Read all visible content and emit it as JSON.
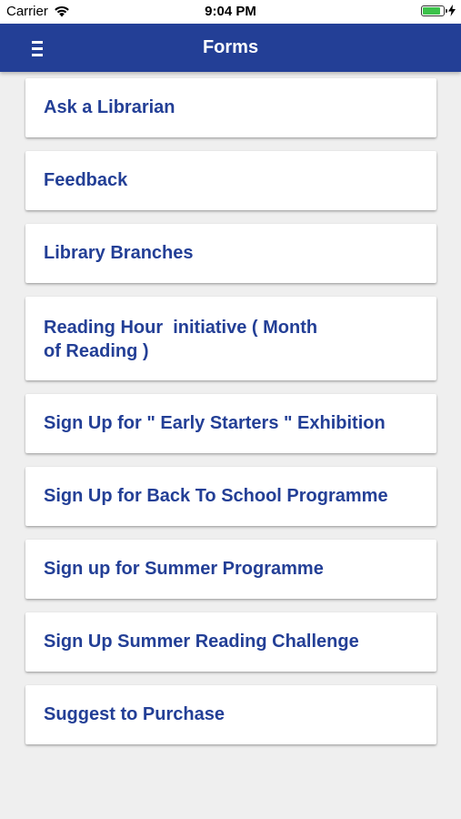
{
  "status_bar": {
    "carrier": "Carrier",
    "time": "9:04 PM",
    "battery_level": 0.85,
    "battery_color": "#3cc24a"
  },
  "nav_bar": {
    "title": "Forms",
    "menu_icon": "hamburger-menu-icon",
    "background_color": "#233f96"
  },
  "forms": [
    {
      "label": "Ask a Librarian"
    },
    {
      "label": "Feedback"
    },
    {
      "label": "Library Branches"
    },
    {
      "label": "Reading Hour  initiative ( Month\nof Reading )"
    },
    {
      "label": "Sign Up for \" Early Starters \" Exhibition"
    },
    {
      "label": "Sign Up for Back To School Programme"
    },
    {
      "label": "Sign up for Summer Programme"
    },
    {
      "label": "Sign Up Summer Reading Challenge"
    },
    {
      "label": "Suggest to Purchase"
    }
  ],
  "accent_color": "#233f96"
}
